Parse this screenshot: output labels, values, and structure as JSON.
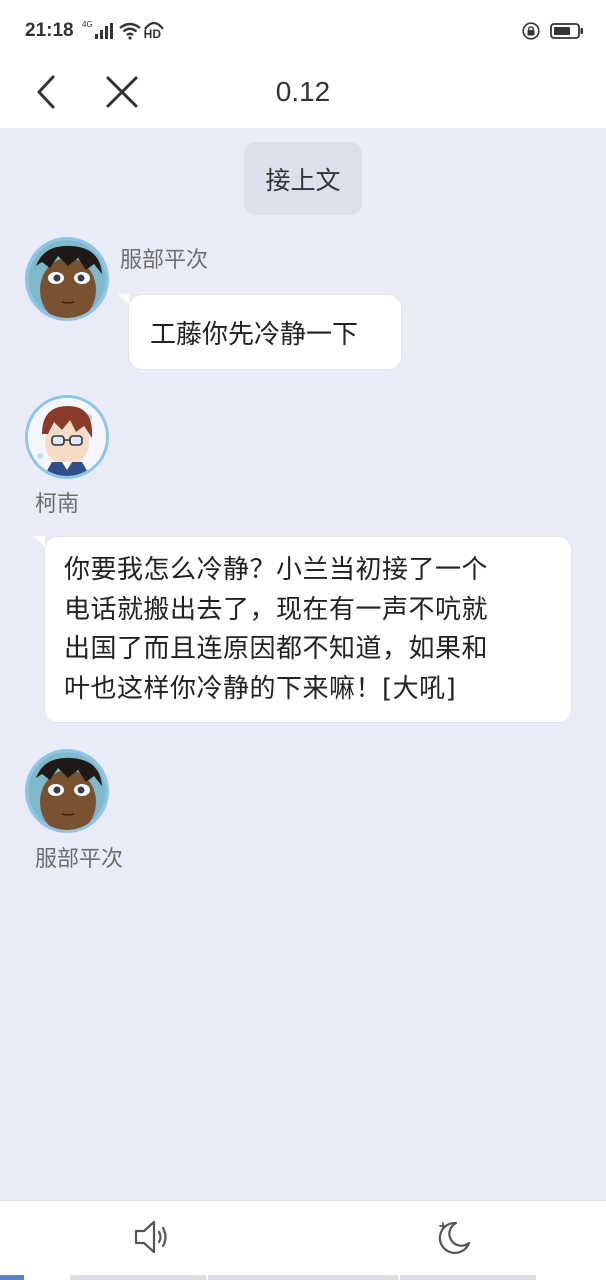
{
  "status_bar": {
    "time": "21:18",
    "network_label": "4G",
    "hd_label": "HD",
    "icons": [
      "signal-icon",
      "wifi-icon",
      "hd-icon",
      "lock-rotation-icon",
      "battery-icon"
    ]
  },
  "header": {
    "title": "0.12",
    "back_icon": "chevron-left-icon",
    "close_icon": "close-icon"
  },
  "chat": {
    "pill_text": "接上文",
    "messages": [
      {
        "speaker": "服部平次",
        "avatar": "heiji-avatar",
        "text": "工藤你先冷静一下"
      },
      {
        "speaker": "柯南",
        "avatar": "conan-avatar",
        "text_lines": [
          "你要我怎么冷静？小兰当初接了一个",
          "电话就搬出去了，现在有一声不吭就",
          "出国了而且连原因都不知道，如果和",
          "叶也这样你冷静的下来嘛！[大吼]"
        ]
      },
      {
        "speaker": "服部平次",
        "avatar": "heiji-avatar"
      }
    ]
  },
  "bottom_bar": {
    "icons": [
      "speaker-icon",
      "night-mode-icon"
    ],
    "progress_segments": 4
  },
  "colors": {
    "background": "#e9ebf7",
    "bubble": "#ffffff",
    "avatar_ring": "#8fc4ea",
    "progress_active": "#5b80c8"
  }
}
